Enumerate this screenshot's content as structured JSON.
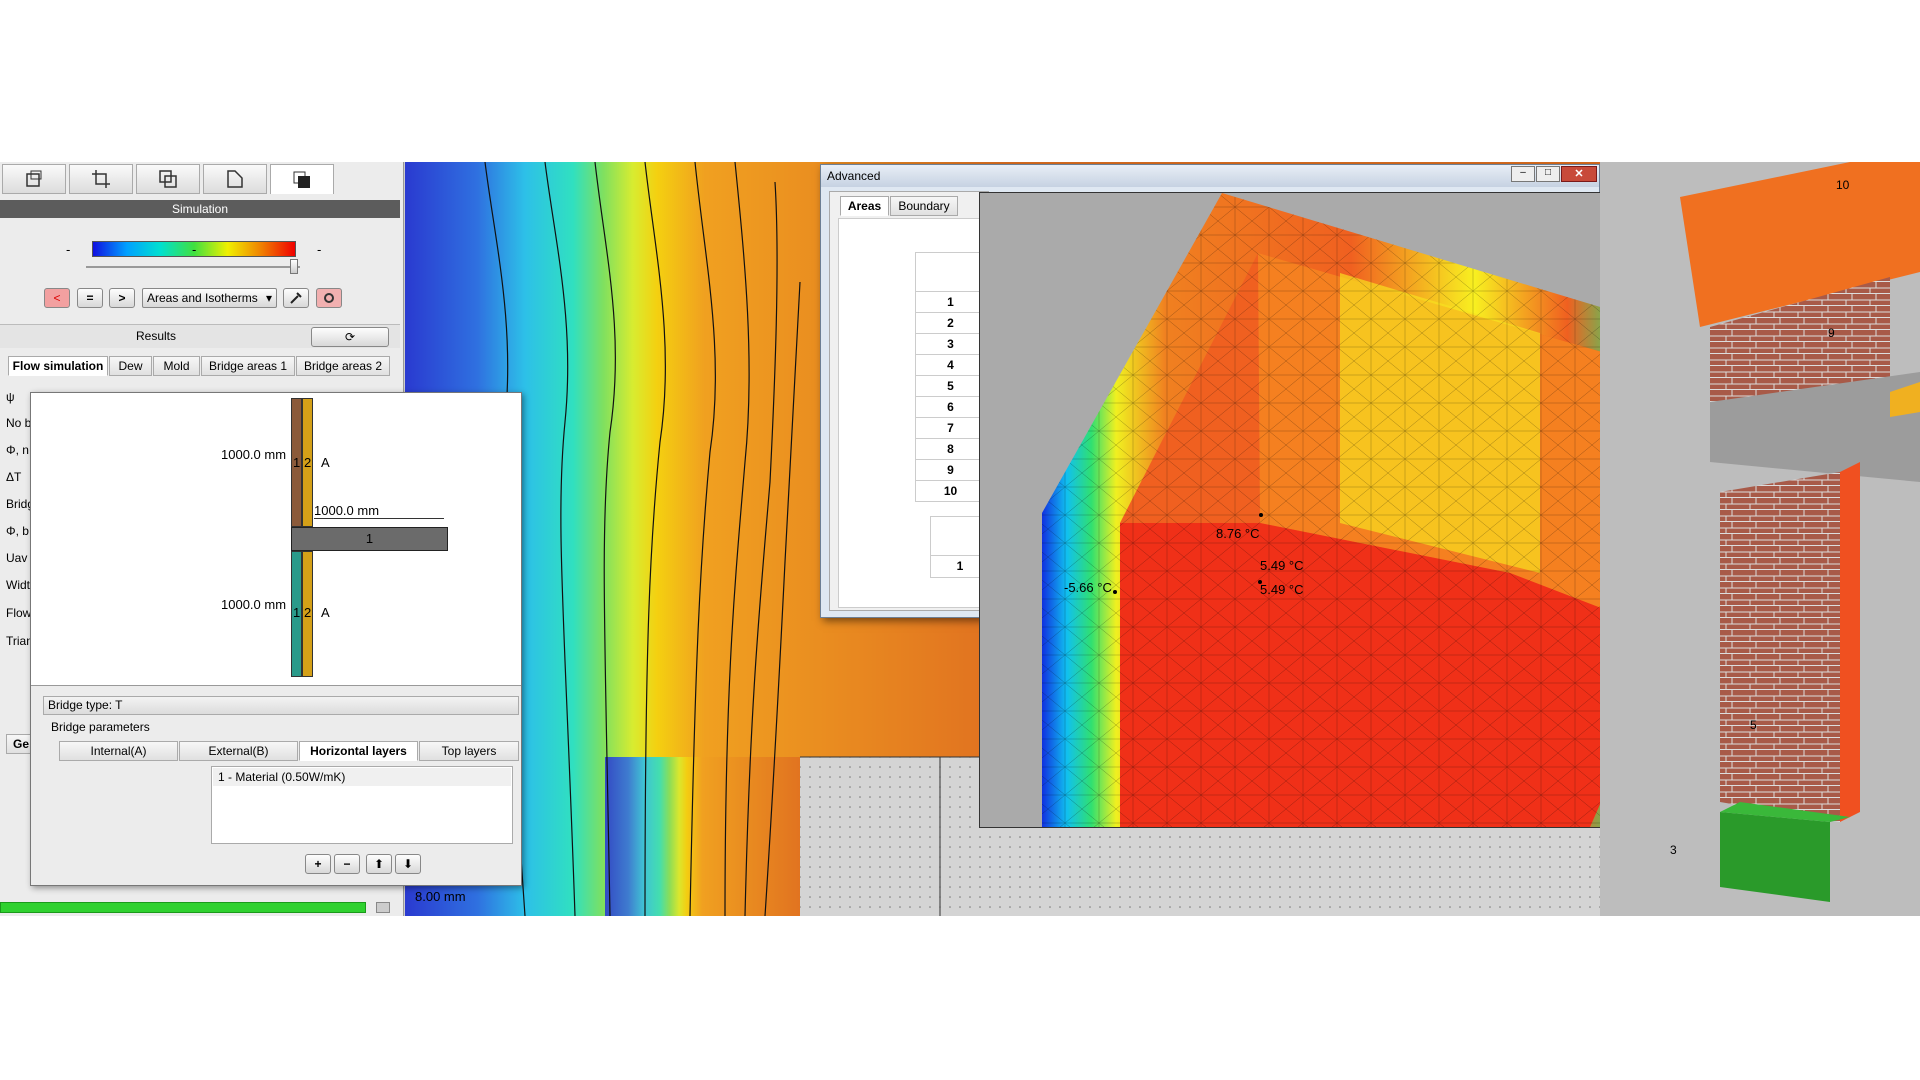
{
  "toolbar": {
    "icons": [
      "draw-area-icon",
      "crop-area-icon",
      "copy-area-icon",
      "shape-icon",
      "layers-icon"
    ]
  },
  "simulation": {
    "title": "Simulation",
    "scale_min": "-",
    "scale_mid": "-",
    "scale_max": "-",
    "prev_label": "<",
    "equal_label": "=",
    "next_label": ">",
    "view_mode": "Areas and Isotherms"
  },
  "results": {
    "title": "Results",
    "tabs": [
      "Flow simulation",
      "Dew",
      "Mold",
      "Bridge areas 1",
      "Bridge areas 2"
    ],
    "rows": [
      "ψ",
      "No b",
      "Φ, n",
      "ΔT",
      "Bridg",
      "Φ, b",
      "Uav",
      "Widt",
      "Flow",
      "Trian"
    ],
    "bottom_tab": "Ge"
  },
  "bridge_dialog": {
    "dim_top": "1000.0 mm",
    "dim_bottom": "1000.0 mm",
    "dim_horizontal": "1000.0 mm",
    "layer_top_labels": [
      "1",
      "2",
      "A"
    ],
    "layer_bottom_labels": [
      "1",
      "2",
      "A"
    ],
    "horizontal_label": "1",
    "bridge_type": "Bridge type: T",
    "params_label": "Bridge parameters",
    "tabs": [
      "Internal(A)",
      "External(B)",
      "Horizontal layers",
      "Top layers"
    ],
    "material": "1 - Material (0.50W/mK)"
  },
  "thermal": {
    "scale_label": "8.00 mm"
  },
  "advanced": {
    "title": "Advanced",
    "tabs": [
      "Areas",
      "Boundary"
    ],
    "rows": [
      "1",
      "2",
      "3",
      "4",
      "5",
      "6",
      "7",
      "8",
      "9",
      "10"
    ],
    "second_row": "1"
  },
  "model": {
    "temps": [
      "8.76 °C",
      "5.49 °C",
      "5.49 °C",
      "-5.66 °C"
    ]
  },
  "right3d": {
    "labels": [
      "10",
      "9",
      "5",
      "3"
    ]
  },
  "colors": {
    "accent_green": "#2fd12f",
    "header_dark": "#5c5c5c"
  }
}
